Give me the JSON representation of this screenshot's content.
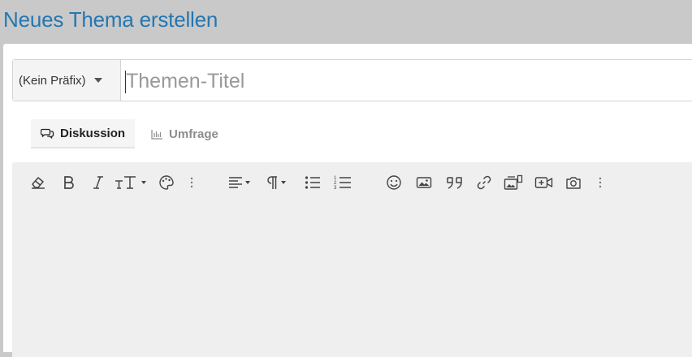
{
  "page": {
    "title": "Neues Thema erstellen"
  },
  "form": {
    "prefix": {
      "selected": "(Kein Präfix)"
    },
    "title_input": {
      "placeholder": "Themen-Titel",
      "value": ""
    }
  },
  "tabs": [
    {
      "label": "Diskussion",
      "icon": "chat-icon",
      "active": true
    },
    {
      "label": "Umfrage",
      "icon": "bar-chart-icon",
      "active": false
    }
  ],
  "toolbar": {
    "buttons": [
      "clear-formatting-icon",
      "bold-icon",
      "italic-icon",
      "text-size-icon",
      "text-color-icon",
      "more-vertical-icon",
      "align-icon",
      "paragraph-icon",
      "bulleted-list-icon",
      "numbered-list-icon",
      "smiley-icon",
      "image-icon",
      "quote-icon",
      "link-icon",
      "media-gallery-icon",
      "video-icon",
      "camera-icon",
      "more-vertical-icon"
    ]
  },
  "colors": {
    "accent": "#2577b1",
    "header_bg": "#c9c9c9",
    "editor_bg": "#efefef"
  }
}
